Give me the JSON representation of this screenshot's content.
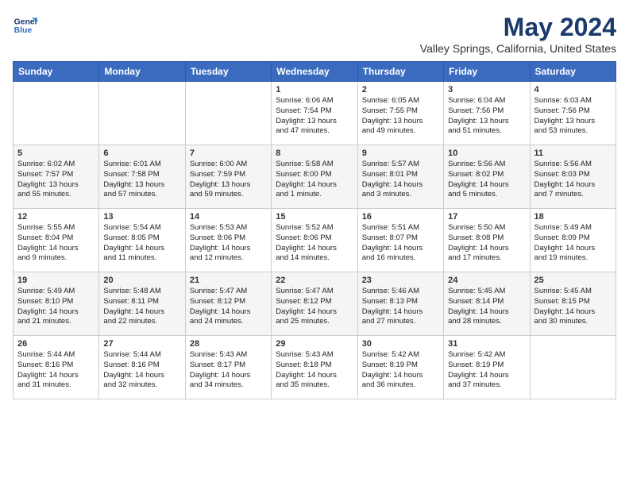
{
  "header": {
    "logo_line1": "General",
    "logo_line2": "Blue",
    "month": "May 2024",
    "location": "Valley Springs, California, United States"
  },
  "weekdays": [
    "Sunday",
    "Monday",
    "Tuesday",
    "Wednesday",
    "Thursday",
    "Friday",
    "Saturday"
  ],
  "weeks": [
    [
      {
        "day": "",
        "info": ""
      },
      {
        "day": "",
        "info": ""
      },
      {
        "day": "",
        "info": ""
      },
      {
        "day": "1",
        "info": "Sunrise: 6:06 AM\nSunset: 7:54 PM\nDaylight: 13 hours\nand 47 minutes."
      },
      {
        "day": "2",
        "info": "Sunrise: 6:05 AM\nSunset: 7:55 PM\nDaylight: 13 hours\nand 49 minutes."
      },
      {
        "day": "3",
        "info": "Sunrise: 6:04 AM\nSunset: 7:56 PM\nDaylight: 13 hours\nand 51 minutes."
      },
      {
        "day": "4",
        "info": "Sunrise: 6:03 AM\nSunset: 7:56 PM\nDaylight: 13 hours\nand 53 minutes."
      }
    ],
    [
      {
        "day": "5",
        "info": "Sunrise: 6:02 AM\nSunset: 7:57 PM\nDaylight: 13 hours\nand 55 minutes."
      },
      {
        "day": "6",
        "info": "Sunrise: 6:01 AM\nSunset: 7:58 PM\nDaylight: 13 hours\nand 57 minutes."
      },
      {
        "day": "7",
        "info": "Sunrise: 6:00 AM\nSunset: 7:59 PM\nDaylight: 13 hours\nand 59 minutes."
      },
      {
        "day": "8",
        "info": "Sunrise: 5:58 AM\nSunset: 8:00 PM\nDaylight: 14 hours\nand 1 minute."
      },
      {
        "day": "9",
        "info": "Sunrise: 5:57 AM\nSunset: 8:01 PM\nDaylight: 14 hours\nand 3 minutes."
      },
      {
        "day": "10",
        "info": "Sunrise: 5:56 AM\nSunset: 8:02 PM\nDaylight: 14 hours\nand 5 minutes."
      },
      {
        "day": "11",
        "info": "Sunrise: 5:56 AM\nSunset: 8:03 PM\nDaylight: 14 hours\nand 7 minutes."
      }
    ],
    [
      {
        "day": "12",
        "info": "Sunrise: 5:55 AM\nSunset: 8:04 PM\nDaylight: 14 hours\nand 9 minutes."
      },
      {
        "day": "13",
        "info": "Sunrise: 5:54 AM\nSunset: 8:05 PM\nDaylight: 14 hours\nand 11 minutes."
      },
      {
        "day": "14",
        "info": "Sunrise: 5:53 AM\nSunset: 8:06 PM\nDaylight: 14 hours\nand 12 minutes."
      },
      {
        "day": "15",
        "info": "Sunrise: 5:52 AM\nSunset: 8:06 PM\nDaylight: 14 hours\nand 14 minutes."
      },
      {
        "day": "16",
        "info": "Sunrise: 5:51 AM\nSunset: 8:07 PM\nDaylight: 14 hours\nand 16 minutes."
      },
      {
        "day": "17",
        "info": "Sunrise: 5:50 AM\nSunset: 8:08 PM\nDaylight: 14 hours\nand 17 minutes."
      },
      {
        "day": "18",
        "info": "Sunrise: 5:49 AM\nSunset: 8:09 PM\nDaylight: 14 hours\nand 19 minutes."
      }
    ],
    [
      {
        "day": "19",
        "info": "Sunrise: 5:49 AM\nSunset: 8:10 PM\nDaylight: 14 hours\nand 21 minutes."
      },
      {
        "day": "20",
        "info": "Sunrise: 5:48 AM\nSunset: 8:11 PM\nDaylight: 14 hours\nand 22 minutes."
      },
      {
        "day": "21",
        "info": "Sunrise: 5:47 AM\nSunset: 8:12 PM\nDaylight: 14 hours\nand 24 minutes."
      },
      {
        "day": "22",
        "info": "Sunrise: 5:47 AM\nSunset: 8:12 PM\nDaylight: 14 hours\nand 25 minutes."
      },
      {
        "day": "23",
        "info": "Sunrise: 5:46 AM\nSunset: 8:13 PM\nDaylight: 14 hours\nand 27 minutes."
      },
      {
        "day": "24",
        "info": "Sunrise: 5:45 AM\nSunset: 8:14 PM\nDaylight: 14 hours\nand 28 minutes."
      },
      {
        "day": "25",
        "info": "Sunrise: 5:45 AM\nSunset: 8:15 PM\nDaylight: 14 hours\nand 30 minutes."
      }
    ],
    [
      {
        "day": "26",
        "info": "Sunrise: 5:44 AM\nSunset: 8:16 PM\nDaylight: 14 hours\nand 31 minutes."
      },
      {
        "day": "27",
        "info": "Sunrise: 5:44 AM\nSunset: 8:16 PM\nDaylight: 14 hours\nand 32 minutes."
      },
      {
        "day": "28",
        "info": "Sunrise: 5:43 AM\nSunset: 8:17 PM\nDaylight: 14 hours\nand 34 minutes."
      },
      {
        "day": "29",
        "info": "Sunrise: 5:43 AM\nSunset: 8:18 PM\nDaylight: 14 hours\nand 35 minutes."
      },
      {
        "day": "30",
        "info": "Sunrise: 5:42 AM\nSunset: 8:19 PM\nDaylight: 14 hours\nand 36 minutes."
      },
      {
        "day": "31",
        "info": "Sunrise: 5:42 AM\nSunset: 8:19 PM\nDaylight: 14 hours\nand 37 minutes."
      },
      {
        "day": "",
        "info": ""
      }
    ]
  ]
}
